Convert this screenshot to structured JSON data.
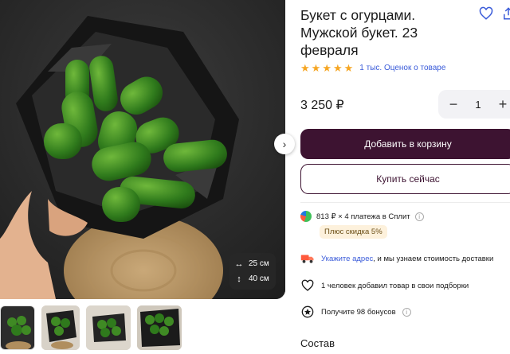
{
  "product": {
    "title": "Букет с огурцами. Мужской букет. 23 февраля",
    "rating": {
      "stars": 5,
      "reviews_label": "1 тыс. Оценок о товаре"
    },
    "price": "3 250 ₽",
    "quantity": "1"
  },
  "photo": {
    "dimension_width": "25 см",
    "dimension_height": "40 см"
  },
  "thumbnails": [
    "bouquet-thumb-1",
    "bouquet-thumb-2",
    "bouquet-thumb-3",
    "bouquet-thumb-4"
  ],
  "actions": {
    "add_to_cart": "Добавить в корзину",
    "buy_now": "Купить сейчас"
  },
  "split": {
    "text": "813 ₽ × 4 платежа в Сплит",
    "discount": "Плюс скидка 5%"
  },
  "delivery": {
    "link": "Укажите адрес",
    "text": ", и мы узнаем стоимость доставки"
  },
  "favorites_note": "1 человек добавил товар в свои подборки",
  "bonus": "Получите 98 бонусов",
  "composition_heading": "Состав",
  "icons": {
    "favorite": "heart-icon",
    "share": "share-icon",
    "next": "chevron-right-icon",
    "width": "horizontal-arrows-icon",
    "height": "vertical-arrows-icon",
    "delivery": "truck-icon",
    "split": "split-logo-icon",
    "bonus": "bonus-icon"
  },
  "colors": {
    "primary": "#3d1331",
    "link": "#3a5bd9",
    "star": "#f6a623",
    "discount_bg": "#fdf1dc"
  }
}
